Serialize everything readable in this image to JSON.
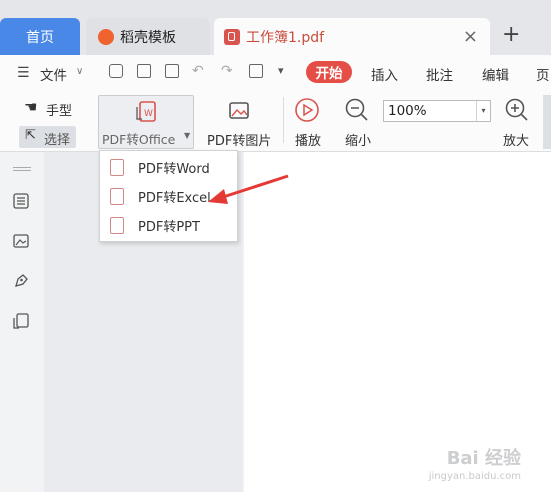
{
  "tabs": {
    "home": "首页",
    "daoke": "稻壳模板",
    "document": "工作簿1.pdf",
    "add": "+",
    "close": "×"
  },
  "menu": {
    "file": "文件",
    "start": "开始",
    "insert": "插入",
    "annotate": "批注",
    "edit": "编辑",
    "page": "页"
  },
  "ribbon": {
    "hand": "手型",
    "select": "选择",
    "pdf_to_office": "PDF转Office",
    "pdf_to_image": "PDF转图片",
    "play": "播放",
    "zoom_out": "缩小",
    "zoom_value": "100%",
    "zoom_in": "放大"
  },
  "dropdown": {
    "items": [
      {
        "label": "PDF转Word"
      },
      {
        "label": "PDF转Excel"
      },
      {
        "label": "PDF转PPT"
      }
    ]
  },
  "colors": {
    "accent": "#4a88e8",
    "start": "#e54e46",
    "arrow": "#e53935"
  },
  "watermark": {
    "text": "Bai 经验",
    "sub": "jingyan.baidu.com"
  }
}
